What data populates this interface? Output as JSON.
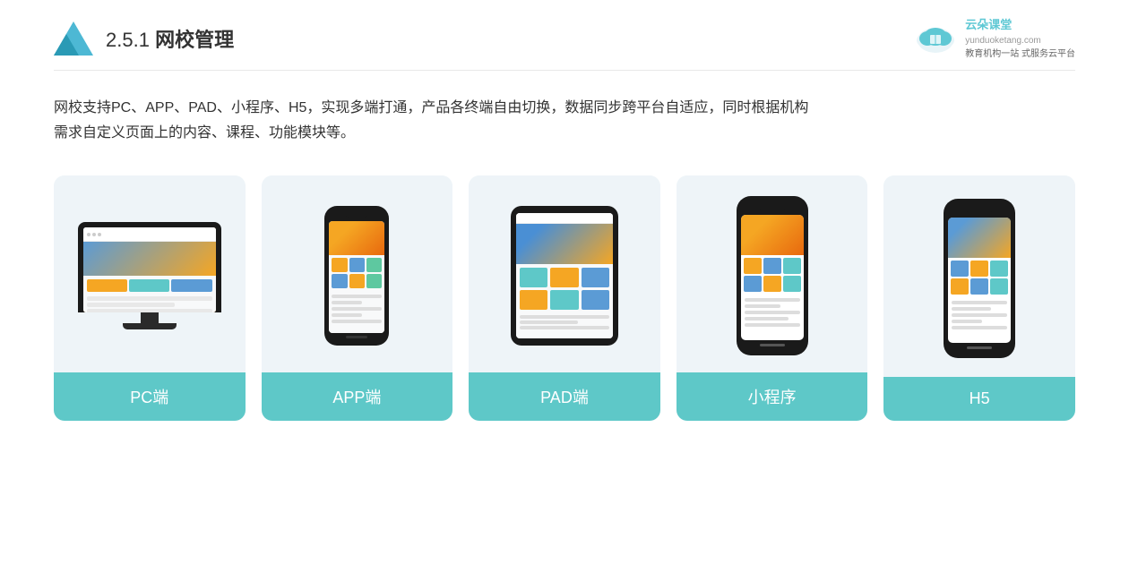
{
  "header": {
    "section_number": "2.5.1",
    "title": "网校管理",
    "brand_name": "云朵课堂",
    "brand_site": "yunduoketang.com",
    "brand_tagline": "教育机构一站\n式服务云平台"
  },
  "description": {
    "line1": "网校支持PC、APP、PAD、小程序、H5，实现多端打通，产品各终端自由切换，数据同步跨平台自适应，同时根据机构",
    "line2": "需求自定义页面上的内容、课程、功能模块等。"
  },
  "cards": [
    {
      "id": "pc",
      "label": "PC端"
    },
    {
      "id": "app",
      "label": "APP端"
    },
    {
      "id": "pad",
      "label": "PAD端"
    },
    {
      "id": "mini",
      "label": "小程序"
    },
    {
      "id": "h5",
      "label": "H5"
    }
  ],
  "colors": {
    "accent": "#5ec8c8",
    "header_bg": "#fff",
    "card_bg": "#eef4f8",
    "label_bg": "#5ec8c8",
    "text_dark": "#333333",
    "text_light": "#ffffff"
  }
}
